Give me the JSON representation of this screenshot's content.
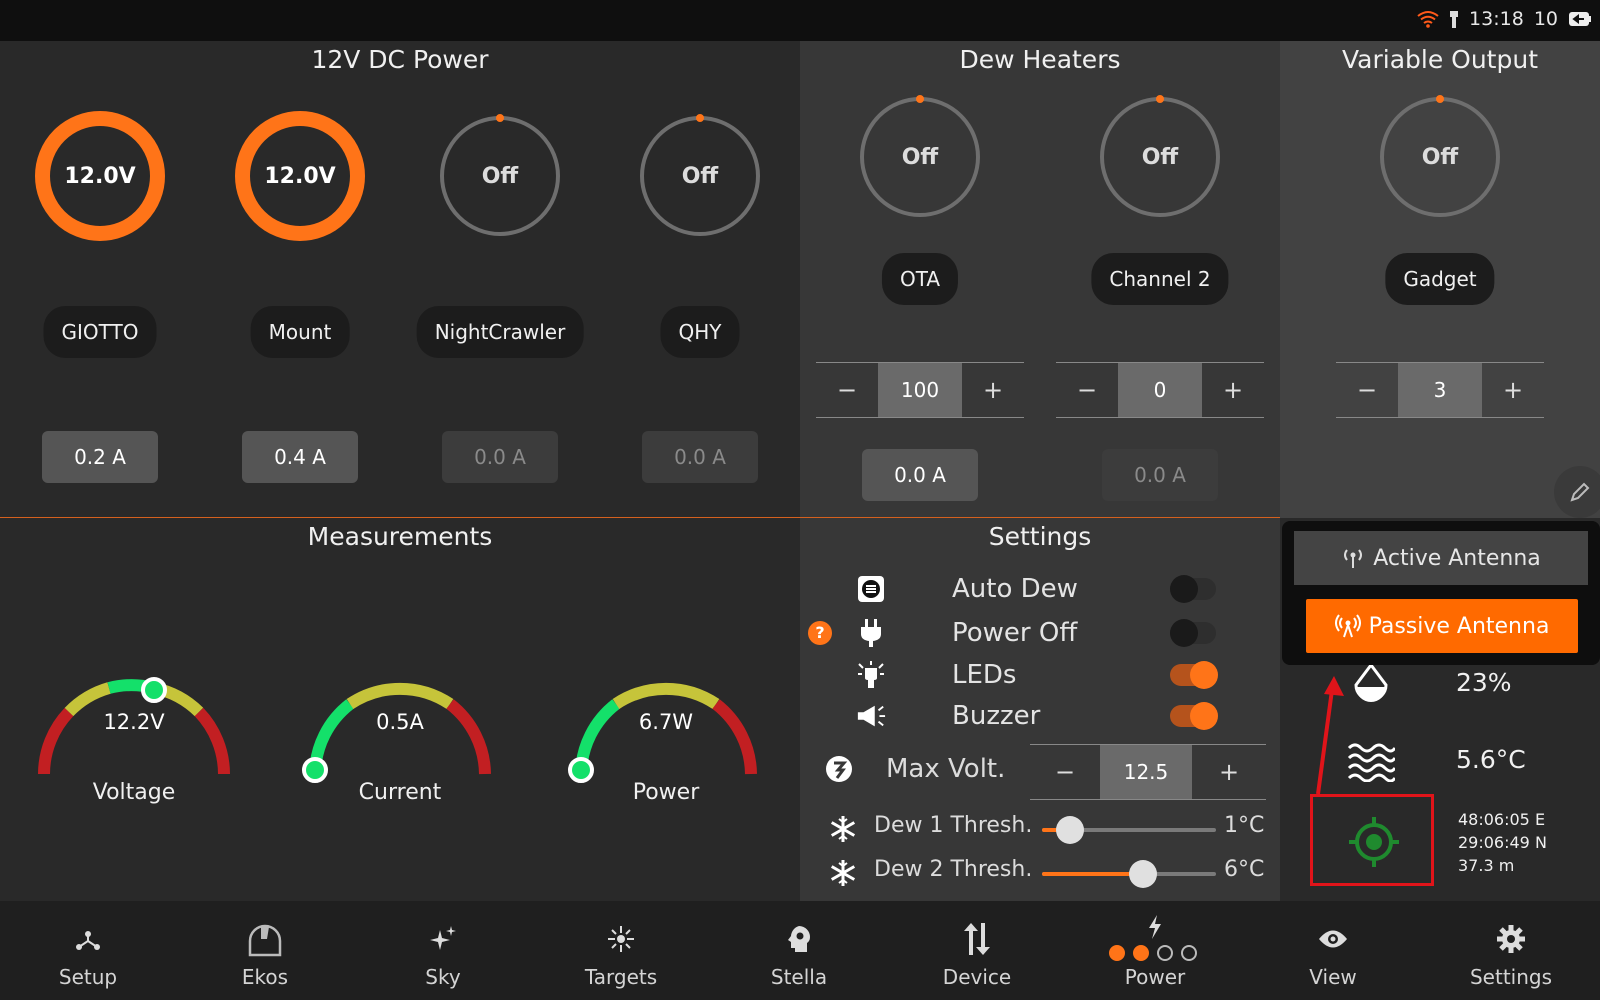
{
  "status_bar": {
    "time": "13:18",
    "battery": "10",
    "icons": [
      "wifi-icon",
      "flashlight-icon",
      "battery-icon"
    ]
  },
  "dc_power": {
    "title": "12V DC Power",
    "ports": [
      {
        "value": "12.0V",
        "label": "GIOTTO",
        "current": "0.2 A",
        "on": true
      },
      {
        "value": "12.0V",
        "label": "Mount",
        "current": "0.4 A",
        "on": true
      },
      {
        "value": "Off",
        "label": "NightCrawler",
        "current": "0.0 A",
        "on": false
      },
      {
        "value": "Off",
        "label": "QHY",
        "current": "0.0 A",
        "on": false
      }
    ]
  },
  "dew_heaters": {
    "title": "Dew Heaters",
    "channels": [
      {
        "value": "Off",
        "label": "OTA",
        "level": "100",
        "current": "0.0 A",
        "current_dim": false
      },
      {
        "value": "Off",
        "label": "Channel 2",
        "level": "0",
        "current": "0.0 A",
        "current_dim": true
      }
    ],
    "minus": "−",
    "plus": "+"
  },
  "variable_output": {
    "title": "Variable Output",
    "value": "Off",
    "label": "Gadget",
    "level": "3"
  },
  "measurements": {
    "title": "Measurements",
    "gauges": [
      {
        "label": "Voltage",
        "value": "12.2V",
        "fraction": 0.62
      },
      {
        "label": "Current",
        "value": "0.5A",
        "fraction": 0.0
      },
      {
        "label": "Power",
        "value": "6.7W",
        "fraction": 0.0
      }
    ]
  },
  "settings": {
    "title": "Settings",
    "toggles": [
      {
        "label": "Auto Dew",
        "icon": "auto-dew-icon",
        "on": false
      },
      {
        "label": "Power Off",
        "icon": "plug-icon",
        "on": false
      },
      {
        "label": "LEDs",
        "icon": "led-bulb-icon",
        "on": true
      },
      {
        "label": "Buzzer",
        "icon": "megaphone-icon",
        "on": true
      }
    ],
    "help": "?",
    "max_volt": {
      "label": "Max Volt.",
      "value": "12.5"
    },
    "dew1": {
      "label": "Dew 1 Thresh.",
      "value": "1°C",
      "level": 0.16
    },
    "dew2": {
      "label": "Dew 2 Thresh.",
      "value": "6°C",
      "level": 0.58
    }
  },
  "antenna_popup": {
    "active_label": "Active Antenna",
    "passive_label": "Passive Antenna",
    "selected": "Passive Antenna"
  },
  "environment": {
    "humidity": "23%",
    "dew_point": "5.6°C",
    "gps": {
      "lon": "48:06:05 E",
      "lat": "29:06:49 N",
      "elevation": "37.3 m"
    }
  },
  "nav": {
    "items": [
      {
        "label": "Setup",
        "icon": "setup-icon"
      },
      {
        "label": "Ekos",
        "icon": "ekos-dome-icon"
      },
      {
        "label": "Sky",
        "icon": "sky-sparkle-icon"
      },
      {
        "label": "Targets",
        "icon": "targets-icon"
      },
      {
        "label": "Stella",
        "icon": "stella-icon"
      },
      {
        "label": "Device",
        "icon": "device-arrows-icon"
      },
      {
        "label": "Power",
        "icon": "power-bolt-icon"
      },
      {
        "label": "View",
        "icon": "eye-icon"
      },
      {
        "label": "Settings",
        "icon": "gear-icon"
      }
    ],
    "pager_active": 2,
    "pager_total": 4
  },
  "colors": {
    "accent": "#ff7418",
    "green": "#14e06a",
    "yellow": "#c6c43a",
    "red": "#c21f22",
    "highlight": "#e0141a"
  }
}
